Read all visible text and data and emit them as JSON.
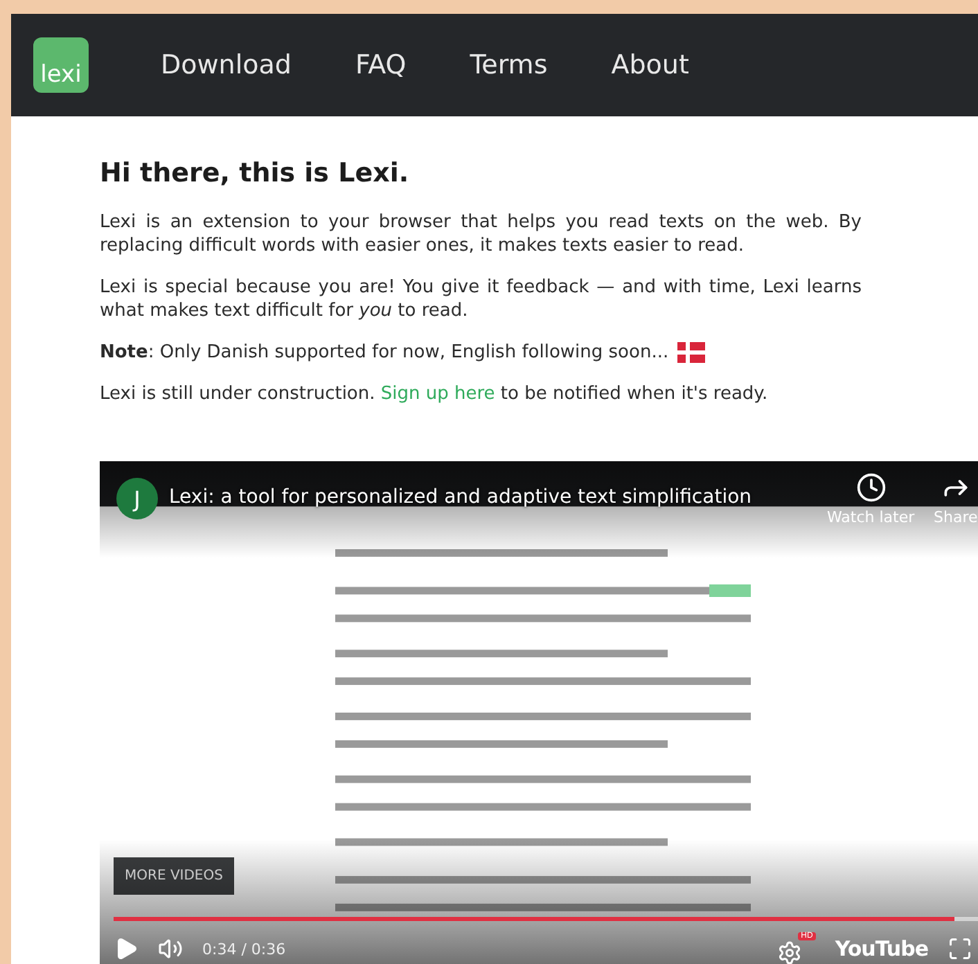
{
  "nav": {
    "logo": "lexi",
    "links": [
      "Download",
      "FAQ",
      "Terms",
      "About"
    ]
  },
  "heading": "Hi there, this is Lexi.",
  "paragraphs": [
    {
      "kind": "text",
      "text": "Lexi is an extension to your browser that helps you read texts on the web. By replacing difficult words with easier ones, it makes texts easier to read."
    },
    {
      "kind": "text",
      "text": "Lexi is special because you are! You give it feedback — and with time, Lexi learns what makes text difficult for *you* to read."
    },
    {
      "kind": "note",
      "text": "**Note**: Only Danish supported for now, English following soon..."
    },
    {
      "kind": "signup",
      "before": "Lexi is still under construction. ",
      "link": "Sign up here",
      "after": " to be notified when it's ready."
    }
  ],
  "video": {
    "avatar": "J",
    "title": "Lexi: a tool for personalized and adaptive text simplification",
    "watch_later": "Watch later",
    "share": "Share",
    "more_videos": "MORE VIDEOS",
    "progress": {
      "level": 0.955
    },
    "time": "0:34 / 0:36",
    "hd_badge": "HD",
    "brand": "YouTube"
  }
}
